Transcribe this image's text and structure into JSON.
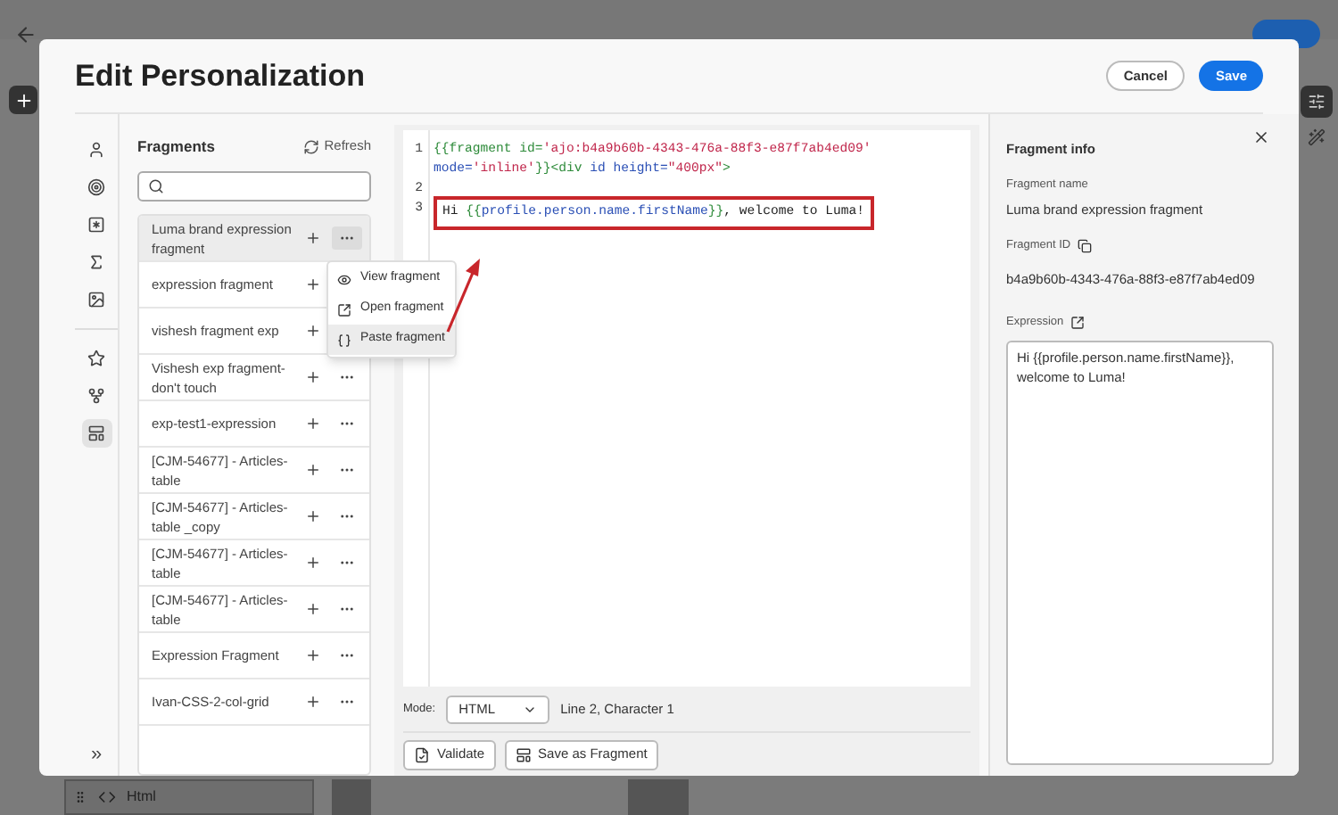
{
  "background_app": {
    "bottom_tab": "Html"
  },
  "dialog": {
    "title": "Edit Personalization",
    "buttons": [
      {
        "label": "Cancel",
        "kind": "secondary"
      },
      {
        "label": "Save",
        "kind": "primary"
      }
    ]
  },
  "rail": {
    "items": [
      {
        "selected": false
      },
      {
        "selected": false
      },
      {
        "selected": false
      },
      {
        "selected": false
      },
      {
        "selected": false
      },
      {
        "selected": false
      },
      {
        "selected": false
      },
      {
        "selected": true
      }
    ],
    "collapse": "»"
  },
  "fragments": {
    "title": "Fragments",
    "refresh": "Refresh",
    "items": [
      {
        "name": "Luma brand expression fragment",
        "selected": true
      },
      {
        "name": "expression fragment",
        "selected": false
      },
      {
        "name": "vishesh fragment exp",
        "selected": false
      },
      {
        "name": "Vishesh exp fragment-don't touch",
        "selected": false
      },
      {
        "name": "exp-test1-expression",
        "selected": false
      },
      {
        "name": "[CJM-54677] - Articles-table",
        "selected": false
      },
      {
        "name": "[CJM-54677] - Articles-table _copy",
        "selected": false
      },
      {
        "name": "[CJM-54677] - Articles-table",
        "selected": false
      },
      {
        "name": "[CJM-54677] - Articles-table",
        "selected": false
      },
      {
        "name": "Expression Fragment",
        "selected": false
      },
      {
        "name": "Ivan-CSS-2-col-grid",
        "selected": false
      }
    ]
  },
  "context_menu": {
    "items": [
      {
        "label": "View fragment",
        "selected": false
      },
      {
        "label": "Open fragment",
        "selected": false
      },
      {
        "label": "Paste fragment",
        "selected": true
      }
    ]
  },
  "editor": {
    "rows": [
      {
        "number": "1",
        "highlighted": false,
        "tokens": [
          {
            "text": "{{fragment id=",
            "kind": "keyword"
          },
          {
            "text": "'ajo:b4a9b60b-4343-476a-88f3-e87f7ab4ed09'",
            "kind": "string"
          }
        ]
      },
      {
        "highlighted": false,
        "tokens": [
          {
            "text": "mode=",
            "kind": "attr"
          },
          {
            "text": "'inline'",
            "kind": "string"
          },
          {
            "text": "}}<div",
            "kind": "keyword"
          },
          {
            "text": " id height=",
            "kind": "attr"
          },
          {
            "text": "\"400px\"",
            "kind": "string"
          },
          {
            "text": ">",
            "kind": "keyword"
          }
        ]
      },
      {
        "number": "2",
        "highlighted": false
      },
      {
        "number": "3",
        "highlighted": true,
        "tokens": [
          {
            "text": "Hi ",
            "kind": "plain"
          },
          {
            "text": "{{",
            "kind": "keyword"
          },
          {
            "text": "profile.person.name.firstName",
            "kind": "attr"
          },
          {
            "text": "}}",
            "kind": "keyword"
          },
          {
            "text": ", welcome to Luma!",
            "kind": "plain"
          }
        ]
      }
    ],
    "mode_label": "Mode:",
    "mode": "HTML",
    "cursor": "Line 2, Character 1",
    "validate": "Validate",
    "save_fragment": "Save as Fragment"
  },
  "info": {
    "title": "Fragment info",
    "name_label": "Fragment name",
    "name": "Luma brand expression fragment",
    "id_label": "Fragment ID",
    "id": "b4a9b60b-4343-476a-88f3-e87f7ab4ed09",
    "expression_label": "Expression",
    "expression": "Hi {{profile.person.name.firstName}}, welcome to Luma!"
  }
}
